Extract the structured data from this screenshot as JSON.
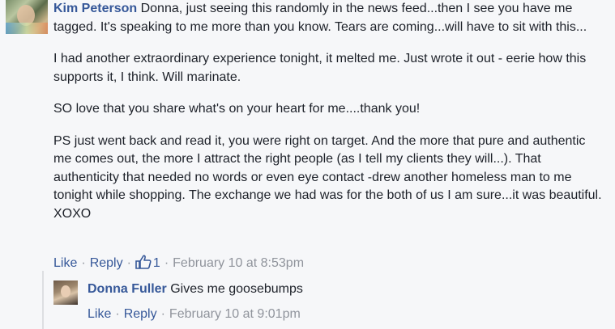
{
  "comment": {
    "author": "Kim Peterson",
    "paragraphs": [
      "Donna, just seeing this randomly in the news feed...then I see you have me tagged. It's speaking to me more than you know. Tears are coming...will have to sit with this...",
      "I had another extraordinary experience tonight, it melted me. Just wrote it out - eerie how this supports it, I think. Will marinate.",
      "SO love that you share what's on your heart for me....thank you!",
      "PS just went back and read it, you were right on target. And the more that pure and authentic me comes out, the more I attract the right people (as I tell my clients they will...). That authenticity that needed no words or even eye contact -drew another homeless man to me tonight while shopping. The exchange we had was for the both of us I am sure...it was beautiful. XOXO"
    ],
    "actions": {
      "like_label": "Like",
      "reply_label": "Reply",
      "like_count": "1",
      "like_icon": "thumbs-up-icon",
      "timestamp": "February 10 at 8:53pm",
      "separator": "·"
    }
  },
  "reply": {
    "author": "Donna Fuller",
    "text": "Gives me goosebumps",
    "actions": {
      "like_label": "Like",
      "reply_label": "Reply",
      "timestamp": "February 10 at 9:01pm",
      "separator": "·"
    }
  },
  "colors": {
    "link": "#365899",
    "meta": "#90949c",
    "text": "#1d2129",
    "background": "#f6f7f9"
  }
}
